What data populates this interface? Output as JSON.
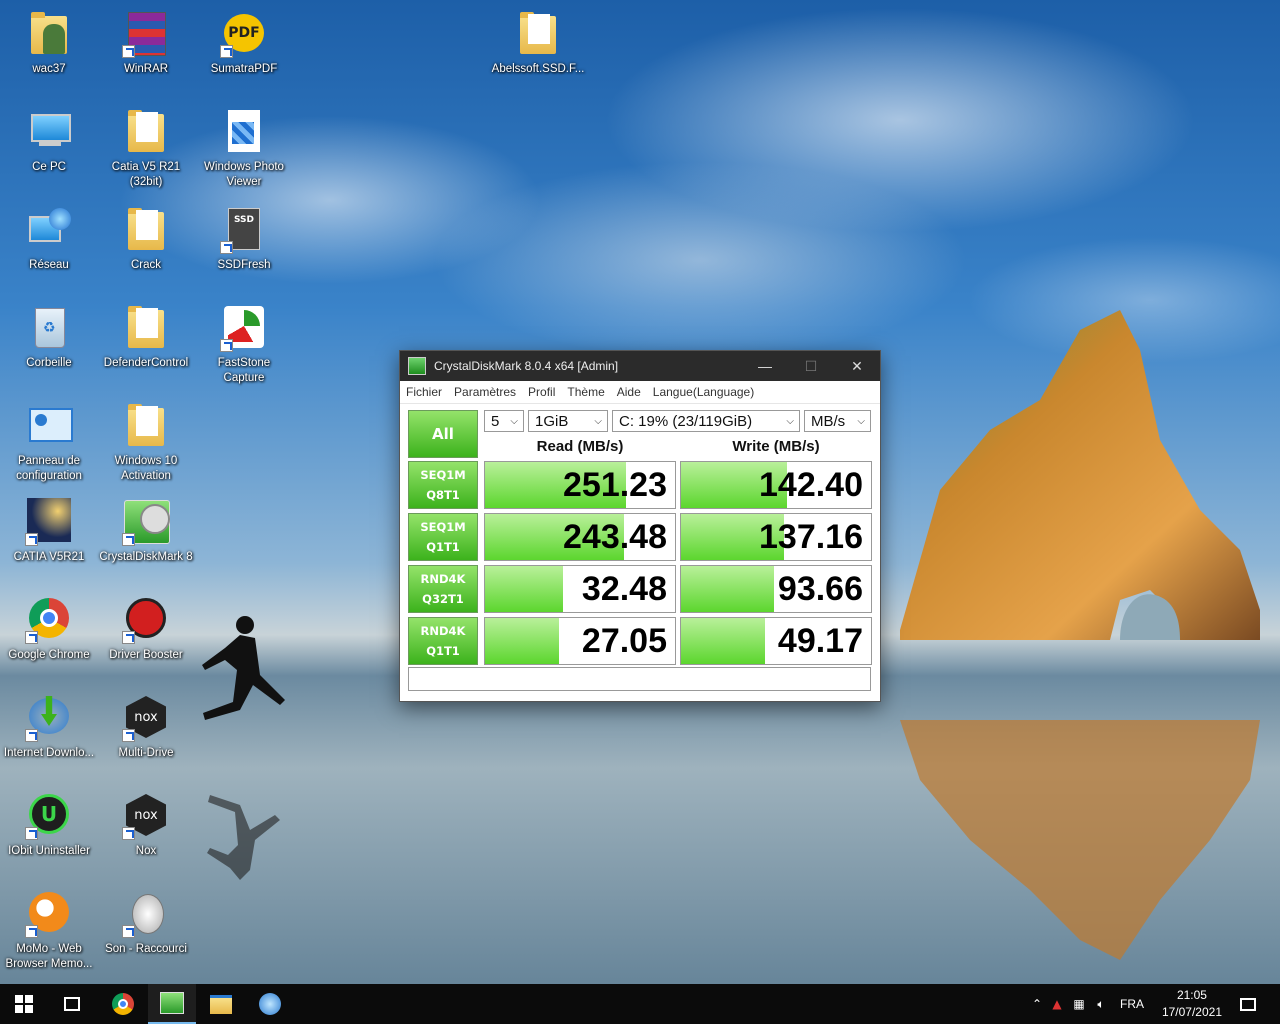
{
  "desktop": {
    "icons": [
      {
        "label": "wac37"
      },
      {
        "label": "WinRAR"
      },
      {
        "label": "SumatraPDF"
      },
      {
        "label": "Abelssoft.SSD.F..."
      },
      {
        "label": "Ce PC"
      },
      {
        "label": "Catia V5 R21 (32bit)"
      },
      {
        "label": "Windows Photo Viewer"
      },
      {
        "label": "Réseau"
      },
      {
        "label": "Crack"
      },
      {
        "label": "SSDFresh"
      },
      {
        "label": "Corbeille"
      },
      {
        "label": "DefenderControl"
      },
      {
        "label": "FastStone Capture"
      },
      {
        "label": "Panneau de configuration"
      },
      {
        "label": "Windows 10 Activation"
      },
      {
        "label": "CATIA V5R21"
      },
      {
        "label": "CrystalDiskMark 8"
      },
      {
        "label": "Google Chrome"
      },
      {
        "label": "Driver Booster"
      },
      {
        "label": "Internet Downlo..."
      },
      {
        "label": "Multi-Drive"
      },
      {
        "label": "IObit Uninstaller"
      },
      {
        "label": "Nox"
      },
      {
        "label": "MoMo - Web Browser Memo..."
      },
      {
        "label": "Son - Raccourci"
      }
    ],
    "icon_texts": {
      "pdf": "PDF",
      "ssd": "SSD",
      "nox": "nox"
    }
  },
  "window": {
    "title": "CrystalDiskMark 8.0.4 x64 [Admin]",
    "minimize": "—",
    "maximize": "☐",
    "close": "✕",
    "menu": [
      "Fichier",
      "Paramètres",
      "Profil",
      "Thème",
      "Aide",
      "Langue(Language)"
    ],
    "all_button": "All",
    "count": "5",
    "size": "1GiB",
    "drive": "C: 19% (23/119GiB)",
    "unit": "MB/s",
    "dropdown_arrow": "⌵",
    "read_header": "Read (MB/s)",
    "write_header": "Write (MB/s)",
    "rows": [
      {
        "line1": "SEQ1M",
        "line2": "Q8T1",
        "read": "251.23",
        "write": "142.40",
        "read_fill": 0.74,
        "write_fill": 0.56
      },
      {
        "line1": "SEQ1M",
        "line2": "Q1T1",
        "read": "243.48",
        "write": "137.16",
        "read_fill": 0.73,
        "write_fill": 0.54
      },
      {
        "line1": "RND4K",
        "line2": "Q32T1",
        "read": "32.48",
        "write": "93.66",
        "read_fill": 0.41,
        "write_fill": 0.49
      },
      {
        "line1": "RND4K",
        "line2": "Q1T1",
        "read": "27.05",
        "write": "49.17",
        "read_fill": 0.39,
        "write_fill": 0.44
      }
    ],
    "comment": ""
  },
  "taskbar": {
    "language": "FRA",
    "time": "21:05",
    "date": "17/07/2021"
  }
}
